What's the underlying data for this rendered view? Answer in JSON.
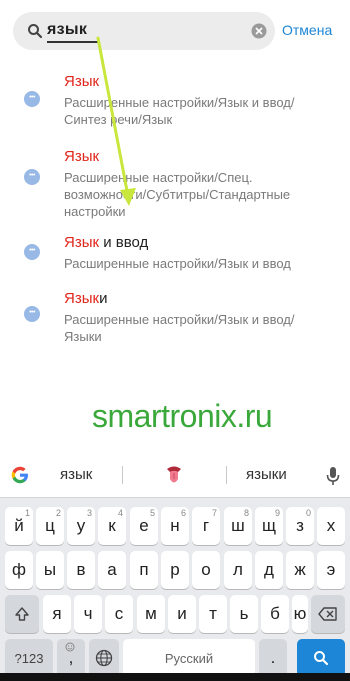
{
  "search": {
    "query": "язык",
    "cancel_label": "Отмена"
  },
  "results": [
    {
      "title_highlight": "Язык",
      "title_rest": "",
      "path_lines": [
        "Расширенные настройки/Язык и ввод/",
        "Синтез речи/Язык"
      ]
    },
    {
      "title_highlight": "Язык",
      "title_rest": "",
      "path_lines": [
        "Расширенные настройки/Спец.",
        "возможности/Субтитры/Стандартные",
        "настройки"
      ]
    },
    {
      "title_highlight": "Язык",
      "title_rest": " и ввод",
      "path_lines": [
        "Расширенные настройки/Язык и ввод"
      ]
    },
    {
      "title_highlight": "Язык",
      "title_rest": "и",
      "path_lines": [
        "Расширенные настройки/Язык и ввод/",
        "Языки"
      ]
    }
  ],
  "watermark": "smartronix.ru",
  "keyboard": {
    "suggestions": [
      "язык",
      "языки"
    ],
    "row1": [
      "й",
      "ц",
      "у",
      "к",
      "е",
      "н",
      "г",
      "ш",
      "щ",
      "з",
      "х"
    ],
    "row1_hints": [
      "1",
      "2",
      "3",
      "4",
      "5",
      "6",
      "7",
      "8",
      "9",
      "0",
      ""
    ],
    "row2": [
      "ф",
      "ы",
      "в",
      "а",
      "п",
      "р",
      "о",
      "л",
      "д",
      "ж",
      "э"
    ],
    "row3": [
      "я",
      "ч",
      "с",
      "м",
      "и",
      "т",
      "ь",
      "б",
      "ю"
    ],
    "num_key": "?123",
    "comma_key": ",",
    "space_label": "Русский",
    "period_key": "."
  },
  "colors": {
    "accent": "#1d86d6",
    "highlight": "#e1261c",
    "watermark": "#3aa83a"
  }
}
